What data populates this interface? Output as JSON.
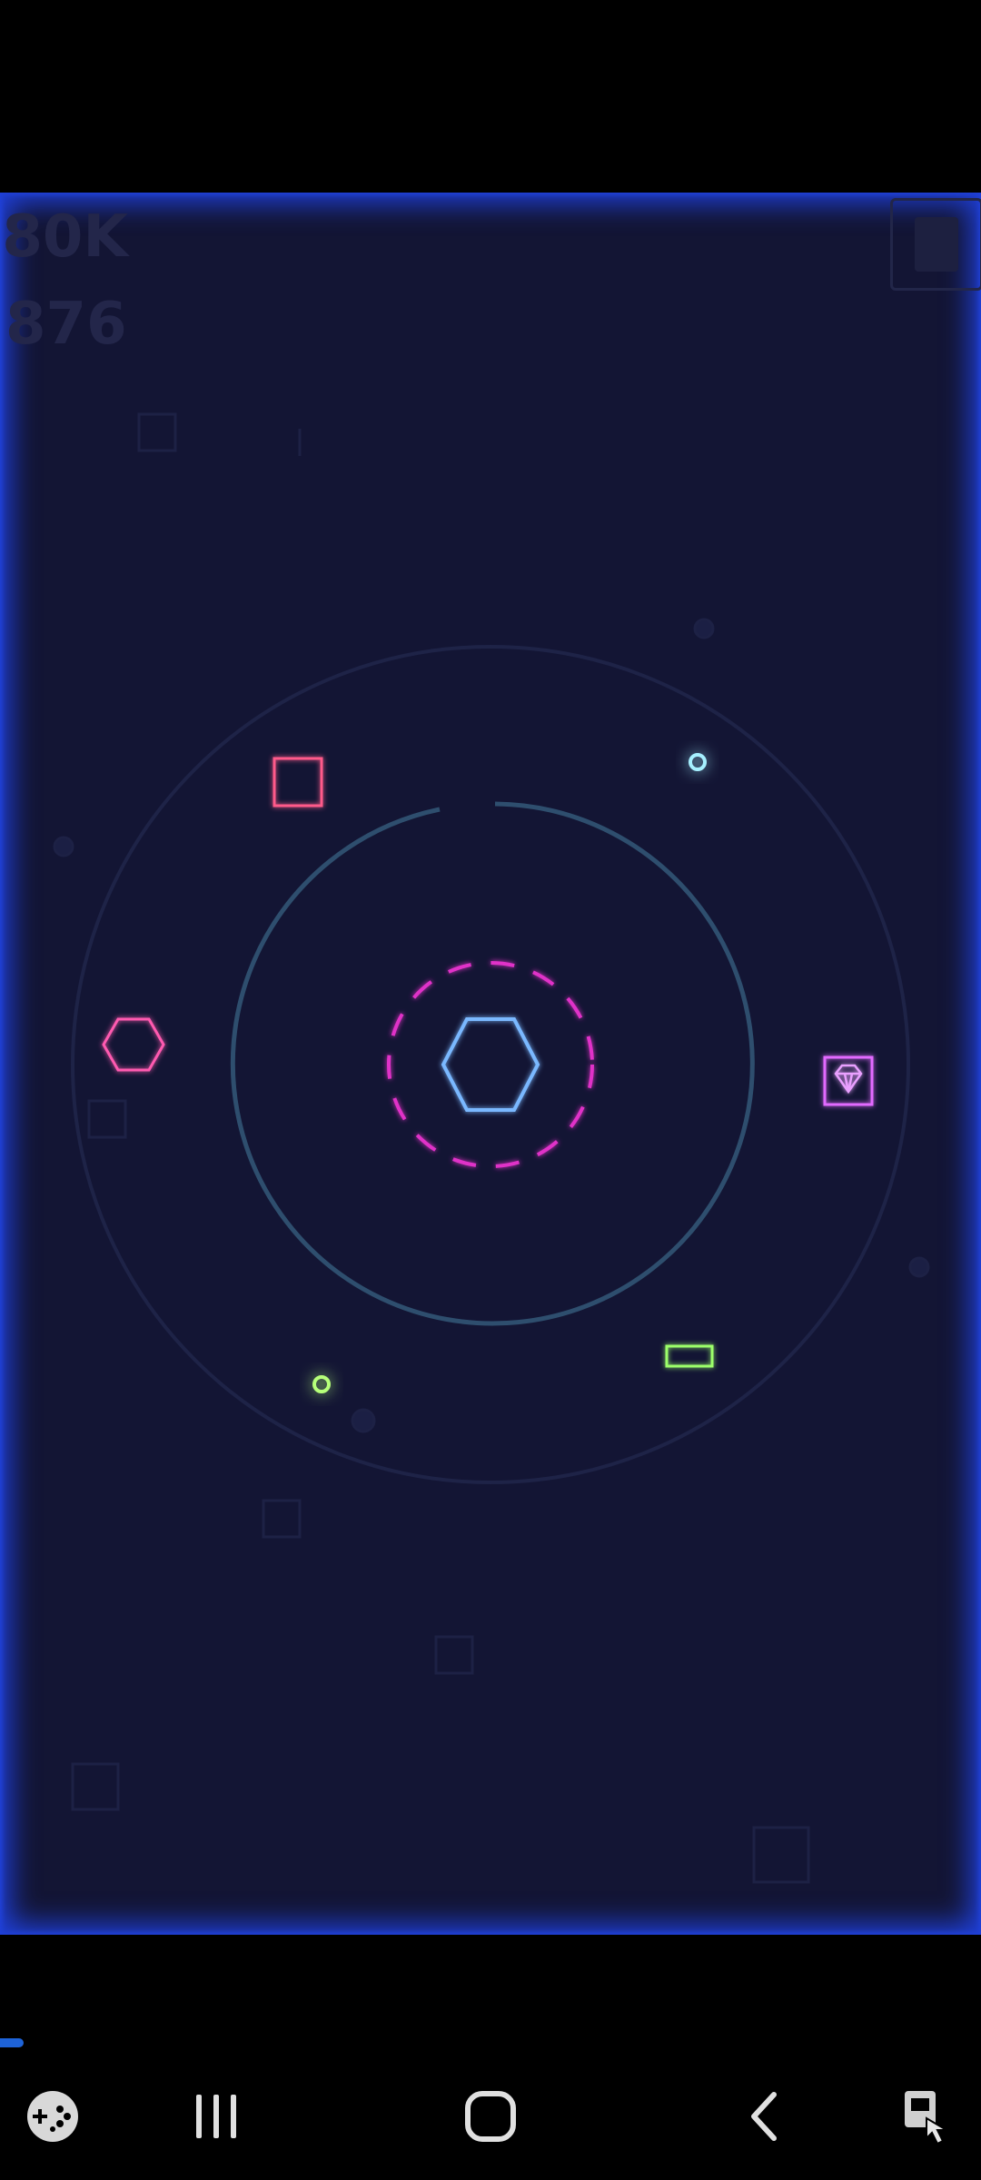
{
  "hud": {
    "score": ".80K",
    "count": "876"
  },
  "colors": {
    "background": "#131534",
    "border_glow": "#1f3fd6",
    "ring": "#2e4e6e",
    "player": "#7ab8ff",
    "shield": "#e030c8",
    "enemy_square": "#ff5a8a",
    "enemy_hexagon": "#ff5ab0",
    "gem_box": "#e26bff",
    "green": "#9cff6b",
    "cyan_orb": "#7fe8ff"
  },
  "nav": {
    "game_tools": "game-tools-icon",
    "recents": "recents-icon",
    "home": "home-icon",
    "back": "back-icon",
    "assist": "touch-assist-icon"
  }
}
